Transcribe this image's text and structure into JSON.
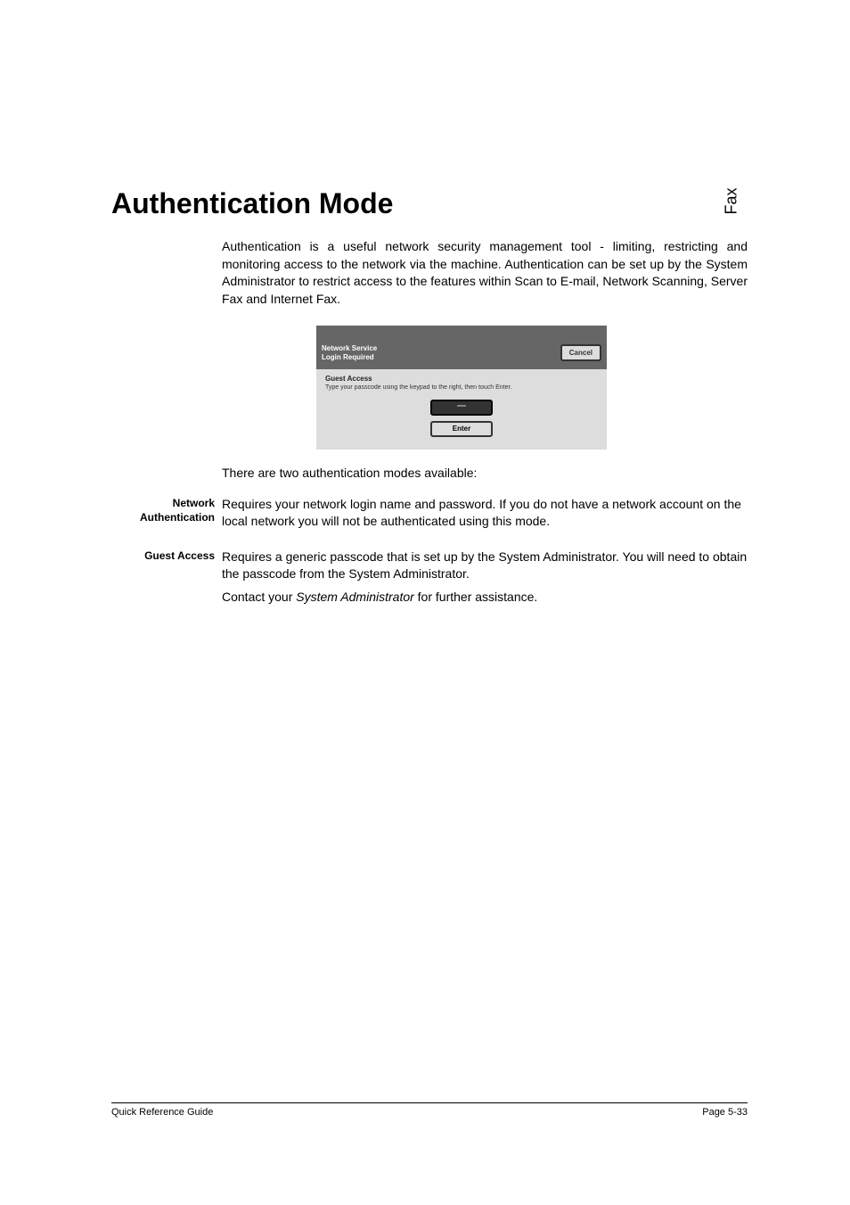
{
  "side_label": "Fax",
  "title": "Authentication Mode",
  "intro": "Authentication is a useful network security management tool - limiting, restricting and monitoring access to the network via the machine. Authentication can be set up by the System Administrator to restrict access to the features within Scan to E-mail, Network Scanning, Server Fax and Internet Fax.",
  "screenshot": {
    "title_line1": "Network Service",
    "title_line2": "Login Required",
    "cancel": "Cancel",
    "body_title": "Guest Access",
    "body_text": "Type your passcode using the keypad to the right, then touch Enter.",
    "input_placeholder": "*****",
    "enter": "Enter"
  },
  "modes_intro": "There are two authentication modes available:",
  "definitions": {
    "network": {
      "term_line1": "Network",
      "term_line2": "Authentication",
      "desc": "Requires your network login name and password. If you do not have a network account on the local network you will not be authenticated using this mode."
    },
    "guest": {
      "term": "Guest Access",
      "desc1": "Requires a generic passcode that is set up by the System Administrator. You will need to obtain the passcode from the System Administrator.",
      "desc2_prefix": "Contact your ",
      "desc2_italic": "System Administrator",
      "desc2_suffix": " for further assistance."
    }
  },
  "footer": {
    "left": "Quick Reference Guide",
    "right": "Page 5-33"
  }
}
